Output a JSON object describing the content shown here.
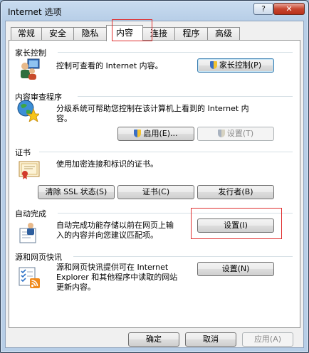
{
  "window": {
    "title": "Internet 选项",
    "help_label": "?",
    "close_label": "✕"
  },
  "tabs": [
    {
      "label": "常规"
    },
    {
      "label": "安全"
    },
    {
      "label": "隐私"
    },
    {
      "label": "内容"
    },
    {
      "label": "连接"
    },
    {
      "label": "程序"
    },
    {
      "label": "高级"
    }
  ],
  "parental": {
    "title": "家长控制",
    "desc": "控制可查看的 Internet 内容。",
    "button": "家长控制(P)"
  },
  "advisor": {
    "title": "内容审查程序",
    "desc_line1": "分级系统可帮助您控制在该计算机上看到的 Internet 内",
    "desc_line2": "容。",
    "enable_button": "启用(E)...",
    "settings_button": "设置(T)"
  },
  "certificates": {
    "title": "证书",
    "desc": "使用加密连接和标识的证书。",
    "clear_ssl_button": "清除 SSL 状态(S)",
    "certs_button": "证书(C)",
    "publishers_button": "发行者(B)"
  },
  "autocomplete": {
    "title": "自动完成",
    "desc_line1": "自动完成功能存储以前在网页上输",
    "desc_line2": "入的内容并向您建议匹配项。",
    "settings_button": "设置(I)"
  },
  "feeds": {
    "title": "源和网页快讯",
    "desc_line1": "源和网页快讯提供可在 Internet",
    "desc_line2": "Explorer 和其他程序中读取的网站",
    "desc_line3": "更新内容。",
    "settings_button": "设置(N)"
  },
  "footer": {
    "ok": "确定",
    "cancel": "取消",
    "apply": "应用(A)"
  }
}
